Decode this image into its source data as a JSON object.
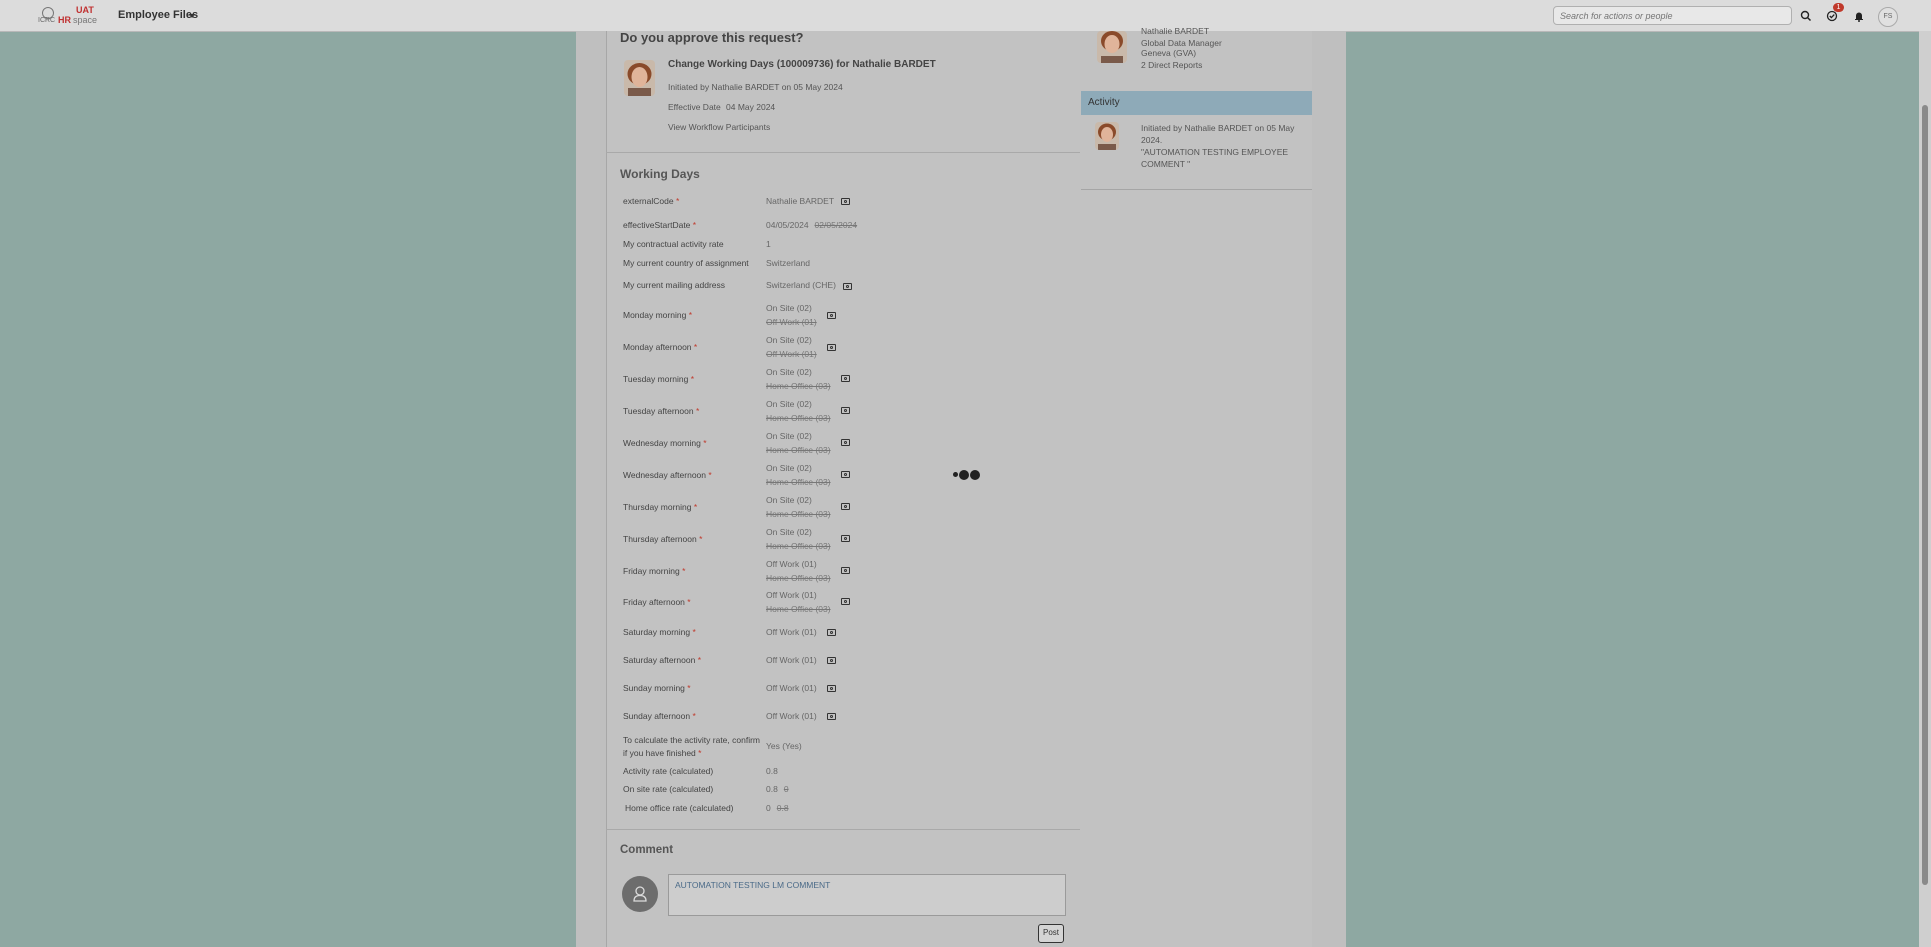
{
  "header": {
    "logo_icrc": "ICRC",
    "logo_uat": "UAT",
    "logo_hr": "HR",
    "logo_space": "space",
    "module_title": "Employee Files",
    "search_placeholder": "Search for actions or people",
    "notification_count": "1",
    "user_initials": "FS"
  },
  "request": {
    "question": "Do you approve this request?",
    "title": "Change Working Days (100009736) for Nathalie BARDET",
    "initiated": "Initiated by Nathalie BARDET on 05 May 2024",
    "effective_label": "Effective Date",
    "effective_date": "04 May 2024",
    "view_participants": "View Workflow Participants"
  },
  "working_days": {
    "title": "Working Days",
    "fields": [
      {
        "label": "externalCode",
        "required": "*",
        "value": "Nathalie BARDET",
        "old": ""
      },
      {
        "label": "effectiveStartDate",
        "required": "*",
        "value": "04/05/2024",
        "old": "02/05/2024"
      },
      {
        "label": "My contractual activity rate",
        "required": "",
        "value": "1",
        "old": ""
      },
      {
        "label": "My current country of assignment",
        "required": "",
        "value": "Switzerland",
        "old": ""
      },
      {
        "label": "My current mailing address",
        "required": "",
        "value": "Switzerland (CHE)",
        "old": ""
      },
      {
        "label": "Monday morning",
        "required": "*",
        "value": "On Site (02)",
        "old": "Off Work (01)"
      },
      {
        "label": "Monday afternoon",
        "required": "*",
        "value": "On Site (02)",
        "old": "Off Work (01)"
      },
      {
        "label": "Tuesday morning",
        "required": "*",
        "value": "On Site (02)",
        "old": "Home Office (03)"
      },
      {
        "label": "Tuesday afternoon",
        "required": "*",
        "value": "On Site (02)",
        "old": "Home Office (03)"
      },
      {
        "label": "Wednesday morning",
        "required": "*",
        "value": "On Site (02)",
        "old": "Home Office (03)"
      },
      {
        "label": "Wednesday afternoon",
        "required": "*",
        "value": "On Site (02)",
        "old": "Home Office (03)"
      },
      {
        "label": "Thursday morning",
        "required": "*",
        "value": "On Site (02)",
        "old": "Home Office (03)"
      },
      {
        "label": "Thursday afternoon",
        "required": "*",
        "value": "On Site (02)",
        "old": "Home Office (03)"
      },
      {
        "label": "Friday morning",
        "required": "*",
        "value": "Off Work (01)",
        "old": "Home Office (03)"
      },
      {
        "label": "Friday afternoon",
        "required": "*",
        "value": "Off Work (01)",
        "old": "Home Office (03)"
      },
      {
        "label": "Saturday morning",
        "required": "*",
        "value": "Off Work (01)",
        "old": ""
      },
      {
        "label": "Saturday afternoon",
        "required": "*",
        "value": "Off Work (01)",
        "old": ""
      },
      {
        "label": "Sunday morning",
        "required": "*",
        "value": "Off Work (01)",
        "old": ""
      },
      {
        "label": "Sunday afternoon",
        "required": "*",
        "value": "Off Work (01)",
        "old": ""
      },
      {
        "label_line1": "To calculate the activity rate, confirm",
        "label_line2": "if you have finished",
        "required": "*",
        "value": "Yes (Yes)",
        "old": ""
      },
      {
        "label": "Activity rate (calculated)",
        "required": "",
        "value": "0.8",
        "old": ""
      },
      {
        "label": "On site rate (calculated)",
        "required": "",
        "value": "0.8",
        "old": "0"
      },
      {
        "label": "Home office rate (calculated)",
        "required": "",
        "value": "0",
        "old": "0.8"
      }
    ]
  },
  "comment": {
    "title": "Comment",
    "text": "AUTOMATION TESTING LM COMMENT",
    "post_label": "Post"
  },
  "side": {
    "name": "Nathalie BARDET",
    "role": "Global Data Manager",
    "location": "Geneva (GVA)",
    "reports": "2 Direct Reports",
    "activity_title": "Activity",
    "activity_text": "Initiated by Nathalie BARDET on 05 May 2024.",
    "activity_comment": "\"AUTOMATION TESTING EMPLOYEE COMMENT \""
  }
}
